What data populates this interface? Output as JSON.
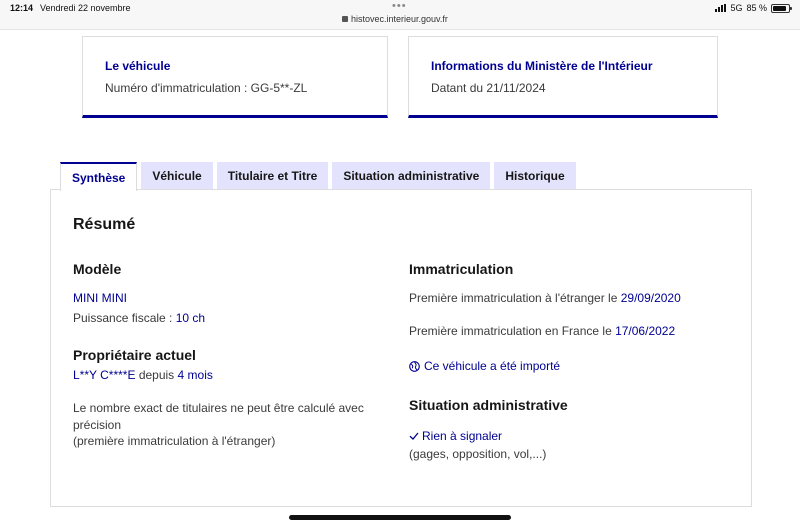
{
  "status_bar": {
    "time": "12:14",
    "date": "Vendredi 22 novembre",
    "url": "histovec.interieur.gouv.fr",
    "network": "5G",
    "battery": "85 %",
    "battery_level": 0.85
  },
  "cards": {
    "vehicle": {
      "title": "Le véhicule",
      "text": "Numéro d'immatriculation : GG-5**-ZL"
    },
    "ministry": {
      "title": "Informations du Ministère de l'Intérieur",
      "text": "Datant du 21/11/2024"
    }
  },
  "tabs": [
    {
      "label": "Synthèse",
      "active": true
    },
    {
      "label": "Véhicule",
      "active": false
    },
    {
      "label": "Titulaire et Titre",
      "active": false
    },
    {
      "label": "Situation administrative",
      "active": false
    },
    {
      "label": "Historique",
      "active": false
    }
  ],
  "summary": {
    "title": "Résumé",
    "model": {
      "heading": "Modèle",
      "name": "MINI MINI",
      "fiscal_label": "Puissance fiscale : ",
      "fiscal_value": "10 ch"
    },
    "owner": {
      "heading": "Propriétaire actuel",
      "name": "L**Y C****E",
      "since_label": " depuis ",
      "since_value": "4 mois",
      "note_line1": "Le nombre exact de titulaires ne peut être calculé avec",
      "note_line2": "précision",
      "note_line3": "(première immatriculation à l'étranger)"
    },
    "registration": {
      "heading": "Immatriculation",
      "foreign_label": "Première immatriculation à l'étranger le ",
      "foreign_date": "29/09/2020",
      "france_label": "Première immatriculation en France le ",
      "france_date": "17/06/2022",
      "imported_label": "Ce véhicule a été importé"
    },
    "admin": {
      "heading": "Situation administrative",
      "status": "Rien à signaler",
      "detail": "(gages, opposition, vol,...)"
    }
  },
  "colors": {
    "accent": "#000091",
    "tab_background": "#e3e3fd",
    "border": "#dddddd"
  },
  "icons": [
    "lock-icon",
    "signal-icon",
    "battery-icon",
    "globe-icon",
    "check-icon"
  ]
}
